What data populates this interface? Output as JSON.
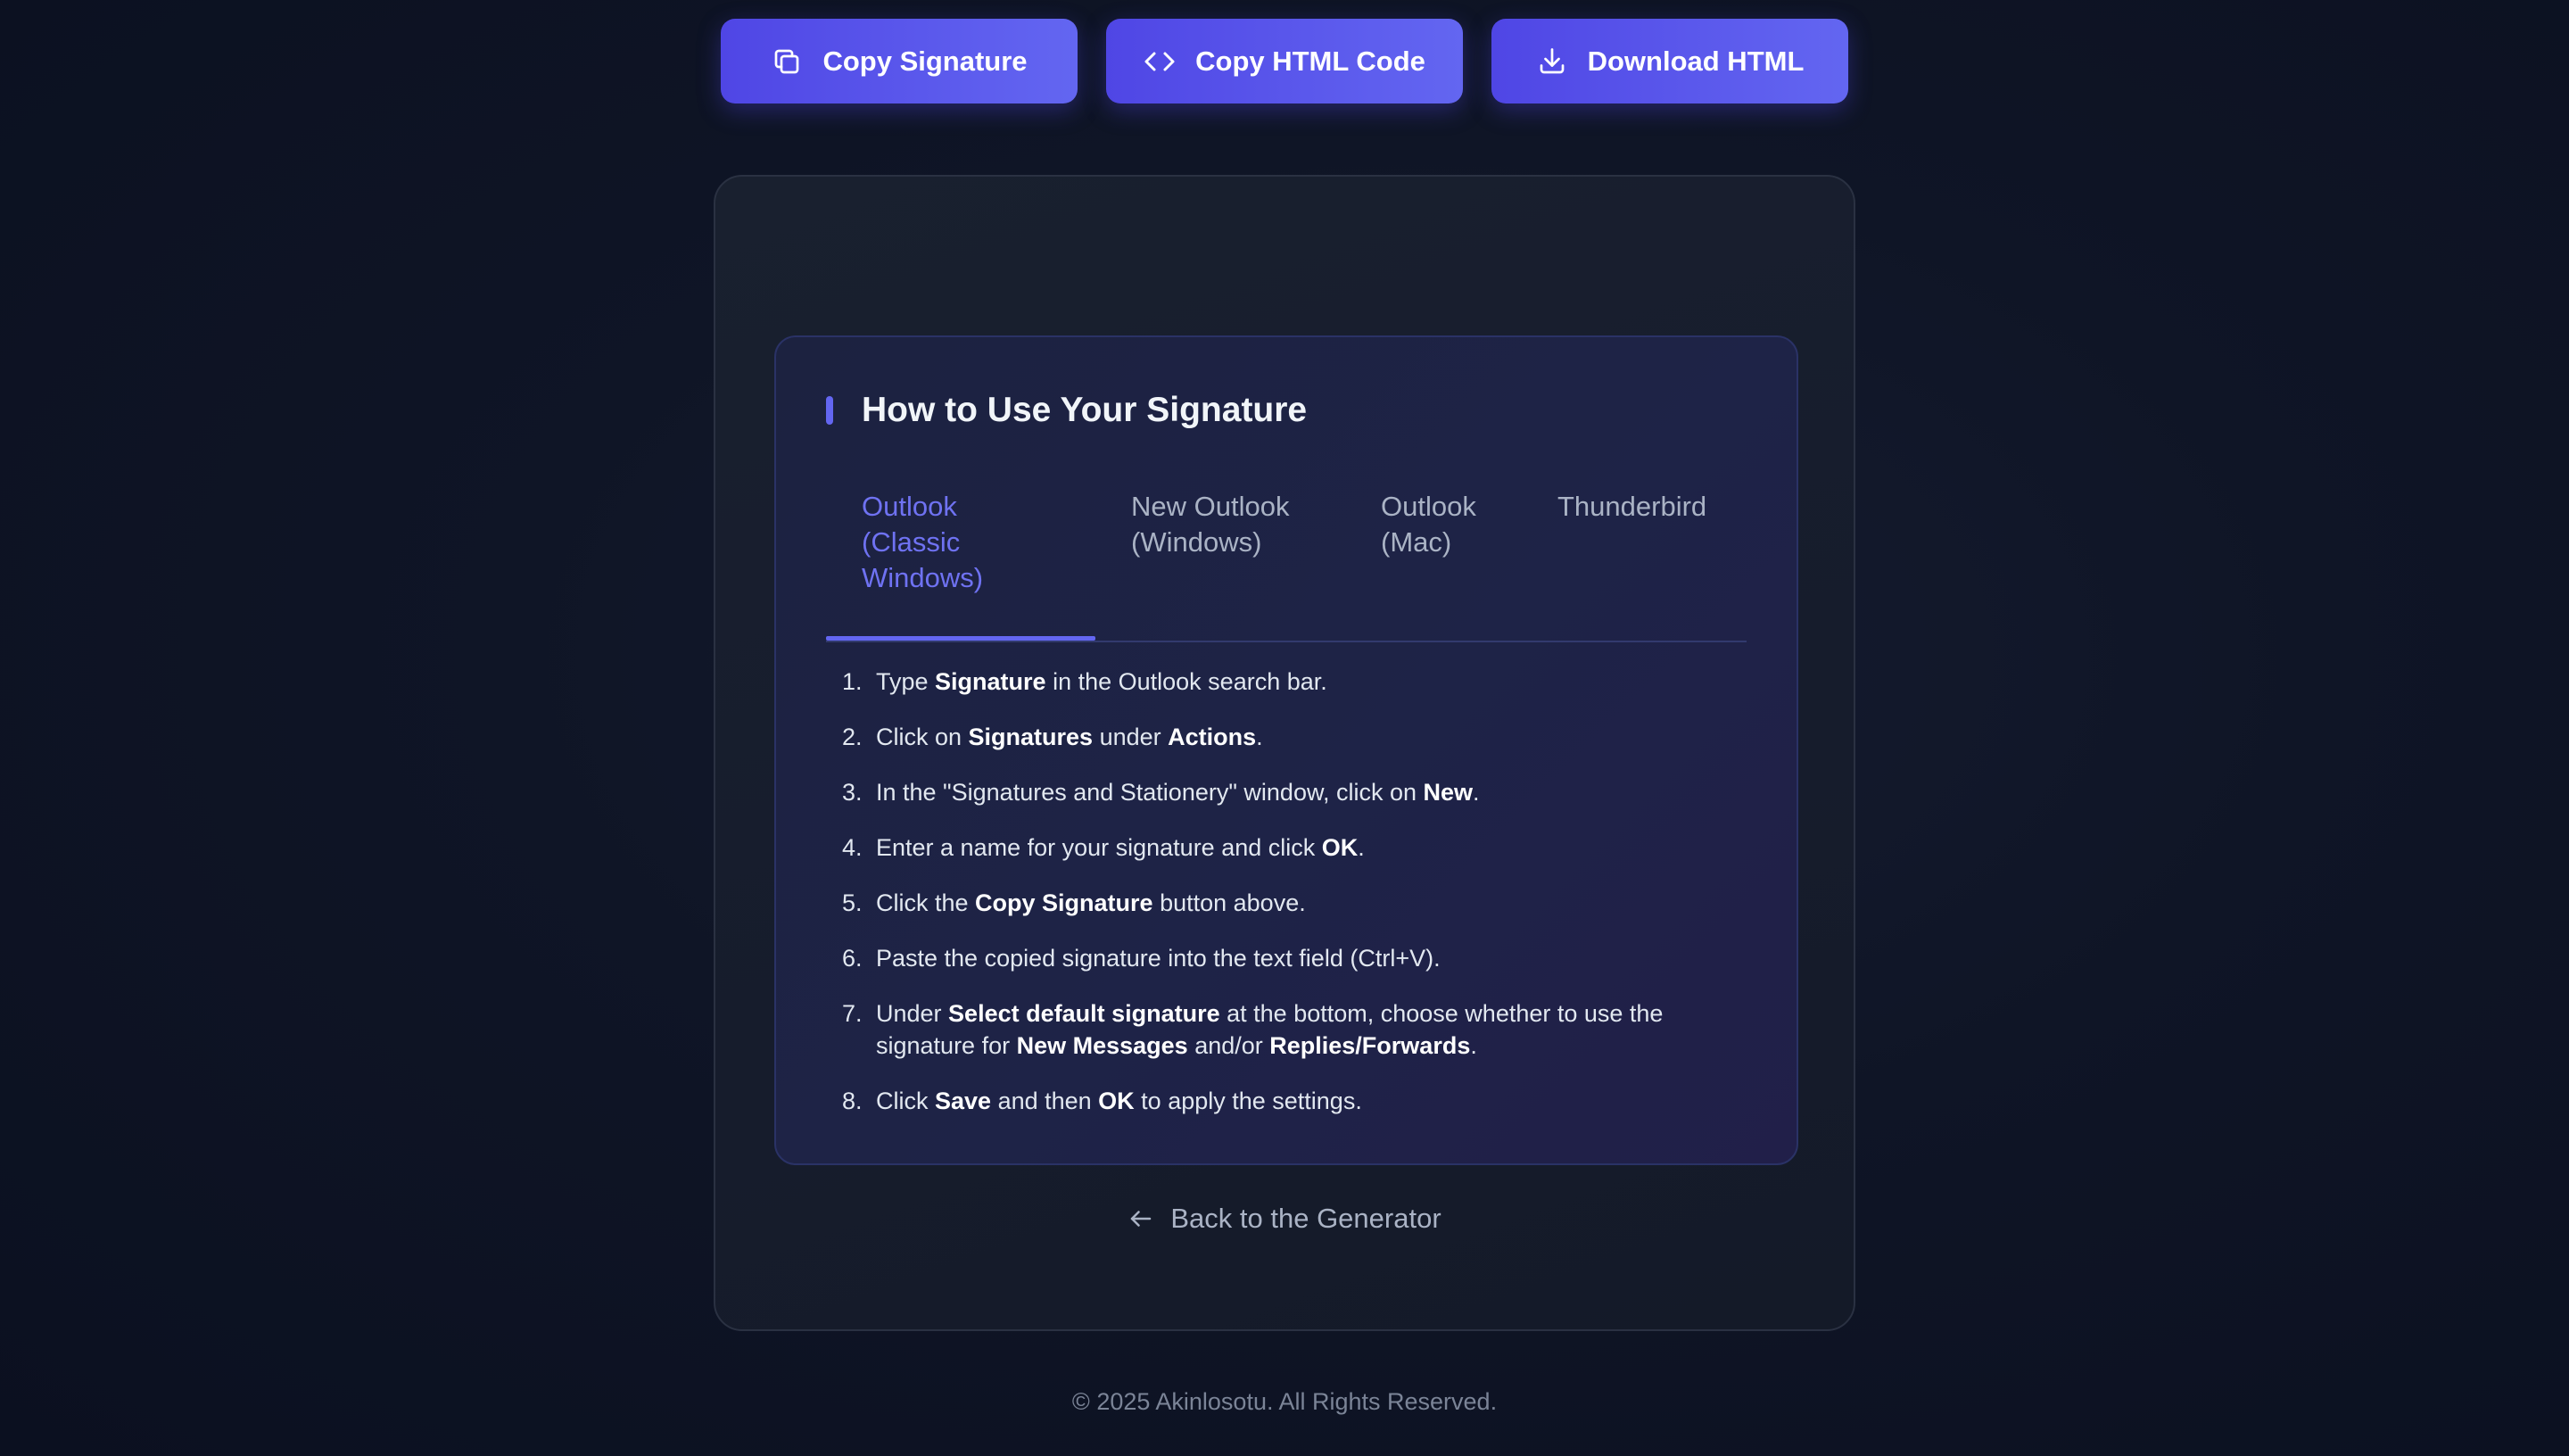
{
  "actions": {
    "copy_signature": "Copy Signature",
    "copy_html": "Copy HTML Code",
    "download_html": "Download HTML"
  },
  "instructions": {
    "title": "How to Use Your Signature",
    "tabs": [
      {
        "lines": [
          "Outlook",
          "(Classic",
          "Windows)"
        ],
        "active": true
      },
      {
        "lines": [
          "New Outlook",
          "(Windows)"
        ],
        "active": false
      },
      {
        "lines": [
          "Outlook",
          "(Mac)"
        ],
        "active": false
      },
      {
        "lines": [
          "Thunderbird"
        ],
        "active": false
      }
    ],
    "steps": [
      {
        "num": "1.",
        "parts": [
          [
            "Type ",
            false
          ],
          [
            "Signature",
            true
          ],
          [
            " in the Outlook search bar.",
            false
          ]
        ]
      },
      {
        "num": "2.",
        "parts": [
          [
            "Click on ",
            false
          ],
          [
            "Signatures",
            true
          ],
          [
            " under ",
            false
          ],
          [
            "Actions",
            true
          ],
          [
            ".",
            false
          ]
        ]
      },
      {
        "num": "3.",
        "parts": [
          [
            "In the \"Signatures and Stationery\" window, click on ",
            false
          ],
          [
            "New",
            true
          ],
          [
            ".",
            false
          ]
        ]
      },
      {
        "num": "4.",
        "parts": [
          [
            "Enter a name for your signature and click ",
            false
          ],
          [
            "OK",
            true
          ],
          [
            ".",
            false
          ]
        ]
      },
      {
        "num": "5.",
        "parts": [
          [
            "Click the ",
            false
          ],
          [
            "Copy Signature",
            true
          ],
          [
            " button above.",
            false
          ]
        ]
      },
      {
        "num": "6.",
        "parts": [
          [
            "Paste the copied signature into the text field (Ctrl+V).",
            false
          ]
        ]
      },
      {
        "num": "7.",
        "parts": [
          [
            "Under ",
            false
          ],
          [
            "Select default signature",
            true
          ],
          [
            " at the bottom, choose whether to use the signature for ",
            false
          ],
          [
            "New Messages",
            true
          ],
          [
            " and/or ",
            false
          ],
          [
            "Replies/Forwards",
            true
          ],
          [
            ".",
            false
          ]
        ]
      },
      {
        "num": "8.",
        "parts": [
          [
            "Click ",
            false
          ],
          [
            "Save",
            true
          ],
          [
            " and then ",
            false
          ],
          [
            "OK",
            true
          ],
          [
            " to apply the settings.",
            false
          ]
        ]
      }
    ]
  },
  "back_link": "Back to the Generator",
  "footer": "© 2025 Akinlosotu. All Rights Reserved.",
  "colors": {
    "accent": "#6366f1",
    "background": "#0f1526",
    "card": "#171d2c"
  },
  "icons": {
    "copy_signature": "copy-icon",
    "copy_html": "code-icon",
    "download_html": "download-icon",
    "back": "arrow-left-icon"
  }
}
